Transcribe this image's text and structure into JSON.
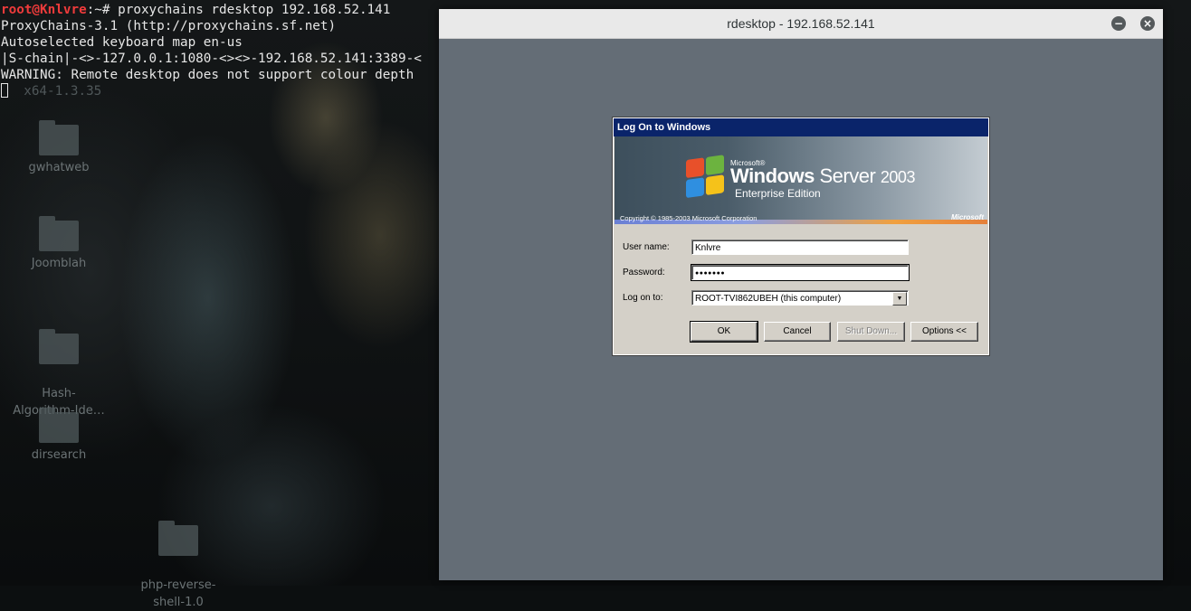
{
  "terminal": {
    "prompt_user": "root@Knlvre",
    "prompt_path": ":~#",
    "command": " proxychains rdesktop 192.168.52.141",
    "lines": [
      "ProxyChains-3.1 (http://proxychains.sf.net)",
      "Autoselected keyboard map en-us",
      "|S-chain|-<>-127.0.0.1:1080-<><>-192.168.52.141:3389-<",
      "WARNING: Remote desktop does not support colour depth"
    ],
    "faint_text": "x64-1.3.35"
  },
  "desktop": {
    "icons": [
      {
        "label": "gwhatweb"
      },
      {
        "label": "Joomblah"
      },
      {
        "label": "Hash-\nAlgorithm-Ide…"
      },
      {
        "label": "dirsearch"
      },
      {
        "label": "php-reverse-\nshell-1.0"
      }
    ]
  },
  "rdesktop": {
    "title": "rdesktop - 192.168.52.141",
    "minimize": "−",
    "close": "×"
  },
  "logon": {
    "title": "Log On to Windows",
    "banner": {
      "microsoft_small": "Microsoft®",
      "product_name": "Windows",
      "product_rest": "Server",
      "product_year": "2003",
      "edition": "Enterprise Edition",
      "copyright": "Copyright © 1985-2003  Microsoft Corporation",
      "ms_logo": "Microsoft"
    },
    "username_label": "User name:",
    "username_value": "Knlvre",
    "password_label": "Password:",
    "password_value": "●●●●●●●",
    "logon_to_label": "Log on to:",
    "logon_to_value": "ROOT-TVI862UBEH (this computer)",
    "buttons": {
      "ok": "OK",
      "cancel": "Cancel",
      "shutdown": "Shut Down...",
      "options": "Options <<"
    }
  },
  "colors": {
    "rdesktop_bg": "#646d76",
    "dialog_title": "#0a246a",
    "dialog_face": "#d4d0c8"
  }
}
